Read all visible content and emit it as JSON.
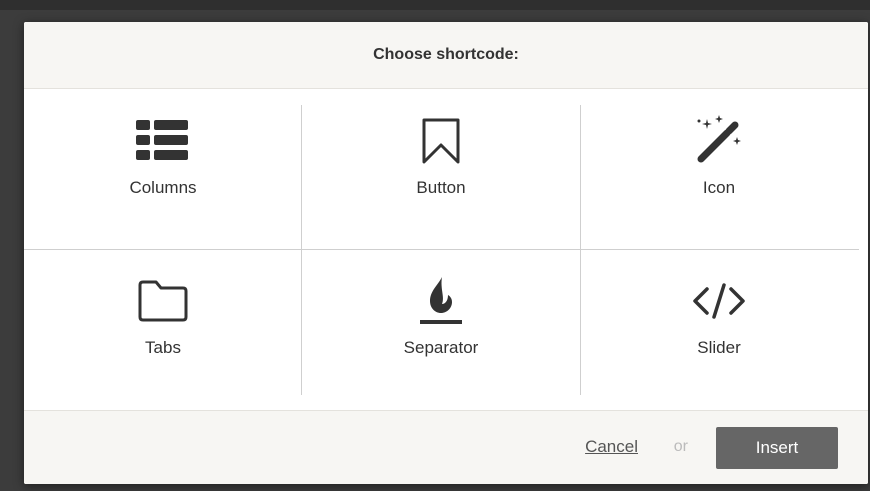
{
  "modal": {
    "title": "Choose shortcode:"
  },
  "shortcodes": [
    {
      "label": "Columns",
      "icon": "list-columns-icon"
    },
    {
      "label": "Button",
      "icon": "bookmark-icon"
    },
    {
      "label": "Icon",
      "icon": "magic-wand-icon"
    },
    {
      "label": "Tabs",
      "icon": "folder-icon"
    },
    {
      "label": "Separator",
      "icon": "flame-separator-icon"
    },
    {
      "label": "Slider",
      "icon": "code-icon"
    }
  ],
  "footer": {
    "cancel_label": "Cancel",
    "or_label": "or",
    "insert_label": "Insert"
  },
  "colors": {
    "header_bg": "#f7f6f3",
    "icon": "#333333",
    "insert_button": "#666666",
    "divider": "#cfcfcf"
  }
}
